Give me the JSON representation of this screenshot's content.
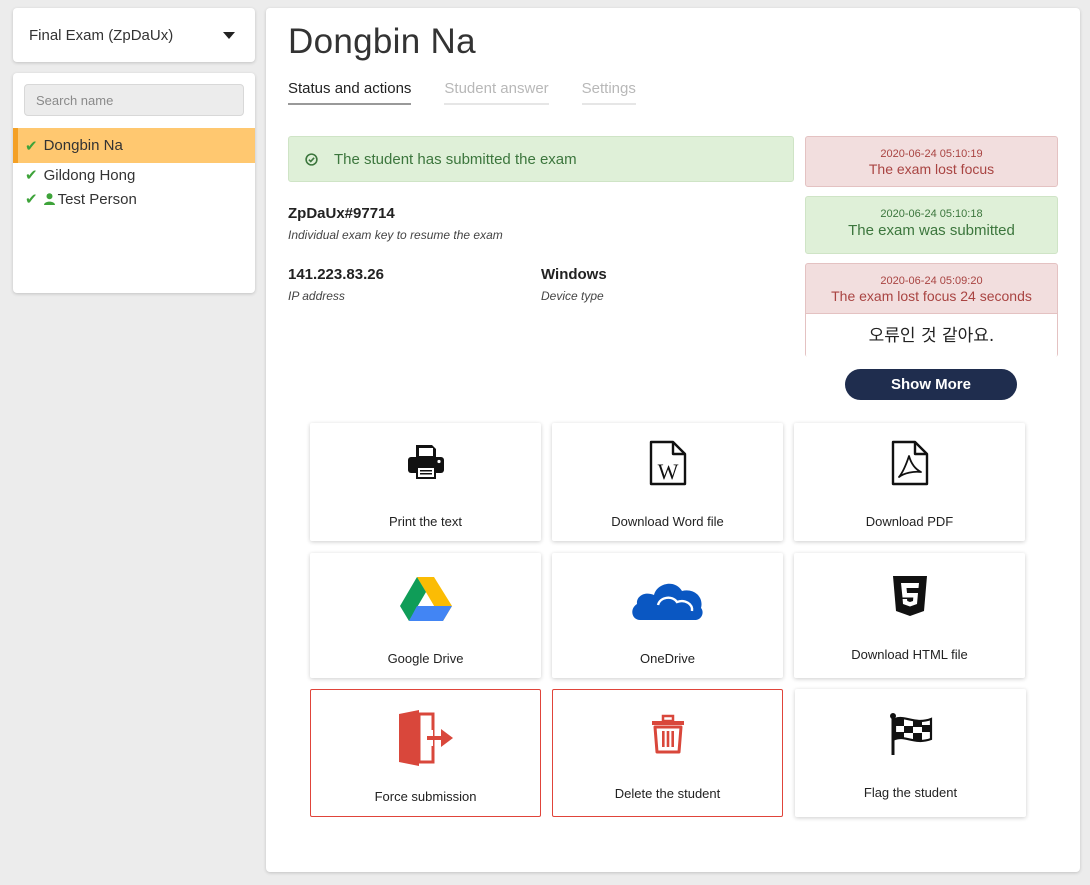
{
  "exam_select": {
    "value": "Final Exam (ZpDaUx)"
  },
  "search": {
    "placeholder": "Search name"
  },
  "students": [
    {
      "name": "Dongbin Na",
      "status": "submitted",
      "active": true
    },
    {
      "name": "Gildong Hong",
      "status": "submitted",
      "active": false
    },
    {
      "name": "Test Person",
      "status": "submitted",
      "has_person_icon": true,
      "active": false
    }
  ],
  "main": {
    "title": "Dongbin Na",
    "tabs": [
      {
        "label": "Status and actions",
        "active": true
      },
      {
        "label": "Student answer",
        "active": false
      },
      {
        "label": "Settings",
        "active": false
      }
    ],
    "status_alert": "The student has submitted the exam",
    "exam_key": {
      "value": "ZpDaUx#97714",
      "label": "Individual exam key to resume the exam"
    },
    "ip": {
      "value": "141.223.83.26",
      "label": "IP address"
    },
    "device": {
      "value": "Windows",
      "label": "Device type"
    }
  },
  "events": [
    {
      "timestamp": "2020-06-24 05:10:19",
      "message": "The exam lost focus",
      "type": "danger"
    },
    {
      "timestamp": "2020-06-24 05:10:18",
      "message": "The exam was submitted",
      "type": "success"
    },
    {
      "timestamp": "2020-06-24 05:09:20",
      "message": "The exam lost focus 24 seconds",
      "type": "danger",
      "note": "오류인 것 같아요."
    }
  ],
  "show_more_label": "Show More",
  "actions": [
    {
      "label": "Print the text",
      "icon": "printer-icon"
    },
    {
      "label": "Download Word file",
      "icon": "word-file-icon"
    },
    {
      "label": "Download PDF",
      "icon": "pdf-file-icon"
    },
    {
      "label": "Google Drive",
      "icon": "google-drive-icon"
    },
    {
      "label": "OneDrive",
      "icon": "onedrive-icon"
    },
    {
      "label": "Download HTML file",
      "icon": "html5-icon"
    },
    {
      "label": "Force submission",
      "icon": "exit-icon"
    },
    {
      "label": "Delete the student",
      "icon": "trash-icon"
    },
    {
      "label": "Flag the student",
      "icon": "checkered-flag-icon"
    }
  ],
  "colors": {
    "accent_active": "#ffc870",
    "active_border": "#f4a024",
    "success_bg": "#dff0d8",
    "danger_bg": "#f2dede",
    "navy_button": "#1f2d4e",
    "danger_red": "#e0443a",
    "check_green": "#3ea33a"
  }
}
